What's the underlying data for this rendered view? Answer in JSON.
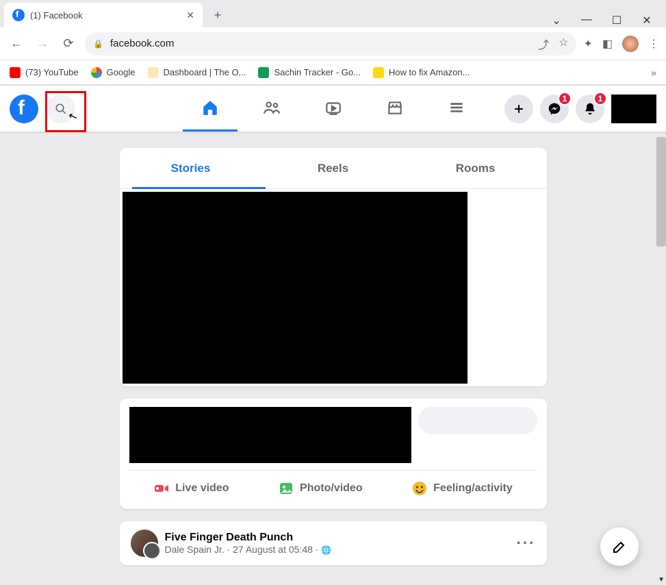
{
  "browser": {
    "tab_title": "(1) Facebook",
    "url": "facebook.com",
    "bookmarks": [
      {
        "label": "(73) YouTube"
      },
      {
        "label": "Google"
      },
      {
        "label": "Dashboard | The O..."
      },
      {
        "label": "Sachin Tracker - Go..."
      },
      {
        "label": "How to fix Amazon..."
      }
    ]
  },
  "fb": {
    "messenger_badge": "1",
    "notif_badge": "1",
    "story_tabs": {
      "stories": "Stories",
      "reels": "Reels",
      "rooms": "Rooms"
    },
    "composer": {
      "live": "Live video",
      "photo": "Photo/video",
      "feeling": "Feeling/activity"
    },
    "post": {
      "name": "Five Finger Death Punch",
      "author": "Dale Spain Jr.",
      "time": "27 August at 05:48"
    }
  }
}
